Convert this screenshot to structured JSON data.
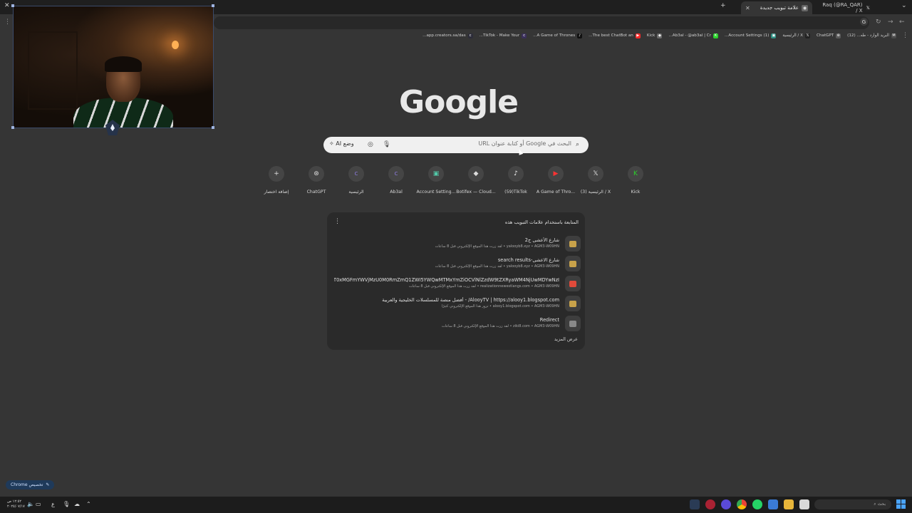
{
  "tabs": [
    {
      "title": "علامة تبويب جديدة",
      "active": true
    },
    {
      "title": "Raq (@RA_QAR) / X",
      "active": false
    }
  ],
  "bookmarks": [
    {
      "label": "البريد الوارد - طه... (12)",
      "icon": "gmail-icon",
      "color": "#4b4b4b"
    },
    {
      "label": "ChatGPT",
      "icon": "chatgpt-icon",
      "color": "#5a5a5a"
    },
    {
      "label": "X / الرئيسية",
      "icon": "x-icon",
      "color": "#222222"
    },
    {
      "label": "(1) Account Settings...",
      "icon": "settings-icon",
      "color": "#2f8f83"
    },
    {
      "label": "Ab3al - @ab3al | Cr...",
      "icon": "creator-icon",
      "color": "#2d2d3a"
    },
    {
      "label": "Kick",
      "icon": "kick-icon",
      "color": "#2bd12b"
    },
    {
      "label": "The best ChatBot an...",
      "icon": "chatbot-icon",
      "color": "#6a6a6a"
    },
    {
      "label": "A Game of Thrones...",
      "icon": "youtube-icon",
      "color": "#ff2a2a"
    },
    {
      "label": "TikTok - Make Your...",
      "icon": "tiktok-icon",
      "color": "#111111"
    },
    {
      "label": "app.creators.sa/das...",
      "icon": "creators-icon",
      "color": "#3a2f5a"
    }
  ],
  "search": {
    "placeholder": "البحث في Google أو كتابة عنوان URL",
    "ai_mode": "وضع AI"
  },
  "shortcuts": [
    {
      "label": "Kick",
      "icon": "kick-icon",
      "glyph": "K",
      "color": "#2bd12b"
    },
    {
      "label": "(3) الرئيسية / X",
      "icon": "x-icon",
      "glyph": "𝕏",
      "color": "#e8e8e8"
    },
    {
      "label": "A Game of Thro...",
      "icon": "youtube-icon",
      "glyph": "▶",
      "color": "#ff3333"
    },
    {
      "label": "(59)TikTok",
      "icon": "tiktok-icon",
      "glyph": "♪",
      "color": "#ffffff"
    },
    {
      "label": "Botifex — Cloud...",
      "icon": "botifex-icon",
      "glyph": "◆",
      "color": "#dcdcdc"
    },
    {
      "label": "Account Setting...",
      "icon": "settings-icon",
      "glyph": "▣",
      "color": "#52c8a8"
    },
    {
      "label": "Ab3al",
      "icon": "creator-icon",
      "glyph": "c",
      "color": "#8a7ad8"
    },
    {
      "label": "الرئيسية",
      "icon": "creators-icon",
      "glyph": "c",
      "color": "#8a7ad8"
    },
    {
      "label": "ChatGPT",
      "icon": "chatgpt-icon",
      "glyph": "⊛",
      "color": "#dddddd"
    },
    {
      "label": "إضافة اختصار",
      "icon": "plus-icon",
      "glyph": "+",
      "color": "#e0e0e0"
    }
  ],
  "continue_card": {
    "title": "المتابعة باستخدام علامات التبويب هذه",
    "show_more": "عرض المزيد",
    "rows": [
      {
        "title": "شارع الأعشى ج2",
        "sub": "yalooyb8.xyz • AGM3-W09HN • لقد زرت هذا الموقع الإلكتروني قبل 8 ساعات",
        "icon_color": "#c8a24a"
      },
      {
        "title": "شارع الاعشى-search results",
        "sub": "yalooyb8.xyz • AGM3-W09HN • لقد زرت هذا الموقع الإلكتروني قبل 8 ساعات",
        "icon_color": "#c8a24a"
      },
      {
        "title": "zQ3P2BeT0xMGFmYWVjMzU0M0RmZmQ1ZWI5YWQwMTMxYmZiOCVlNlZzdW9tZXRyaWM4NjUwMDYwNzI...",
        "sub": "realizationnewestlangs.com • AGM3-W09HN • لقد زرت هذا الموقع الإلكتروني قبل 8 ساعات",
        "icon_color": "#e04a3a"
      },
      {
        "title": "AlooyTV | https://alooy1.blogspot.com/ - أفضل منصة للمسلسلات الخليجية والعربية",
        "sub": "alooy1.blogspot.com • AGM3-W09HN • تزور هذا الموقع الإلكتروني كثيرًا",
        "icon_color": "#c8a24a"
      },
      {
        "title": "Redirect",
        "sub": "ziki8.com • AGM3-W09HN • لقد زرت هذا الموقع الإلكتروني قبل 8 ساعات",
        "icon_color": "#888888"
      }
    ]
  },
  "customize_button": "تخصيص Chrome",
  "taskbar": {
    "search_placeholder": "بحث",
    "time": "١٢:٥٢ ص",
    "date": "٢٠٢٥/٠٧/١٧",
    "lang": "ع"
  }
}
